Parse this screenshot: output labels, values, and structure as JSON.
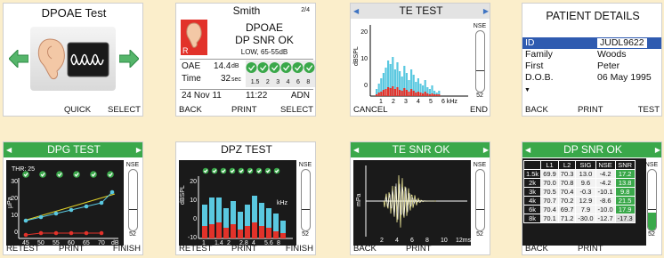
{
  "s1": {
    "title": "DPOAE Test",
    "foot_left": "QUICK",
    "foot_right": "SELECT",
    "icons": [
      "arrow-left-icon",
      "ear-waveform-icon",
      "arrow-right-icon"
    ]
  },
  "s2": {
    "name": "Smith",
    "page": "2/4",
    "test": "DPOAE",
    "result": "DP SNR OK",
    "range": "LOW, 65-55dB",
    "ear": "R",
    "oae_label": "OAE",
    "oae_value": "14.4",
    "oae_unit": "dB",
    "time_label": "Time",
    "time_value": "32",
    "time_unit": "sec",
    "freqs": [
      "1.5",
      "2",
      "3",
      "4",
      "6",
      "8"
    ],
    "date": "24 Nov 11",
    "clock": "11:22",
    "adn": "ADN",
    "foot_left": "BACK",
    "foot_mid": "PRINT",
    "foot_right": "SELECT"
  },
  "s3": {
    "title": "TE TEST",
    "y_label": "dBSPL",
    "y_ticks": [
      "20",
      "10",
      "0"
    ],
    "x_ticks": [
      "1",
      "2",
      "3",
      "4",
      "5",
      "6 kHz"
    ],
    "nse": "NSE",
    "nse_val": "52",
    "foot_left": "CANCEL",
    "foot_right": "END"
  },
  "s4": {
    "title": "PATIENT DETAILS",
    "rows": [
      [
        "ID",
        "JUDL9622"
      ],
      [
        "Family",
        "Woods"
      ],
      [
        "First",
        "Peter"
      ],
      [
        "D.O.B.",
        "06 May 1995"
      ]
    ],
    "foot_left": "BACK",
    "foot_mid": "PRINT",
    "foot_right": "TEST"
  },
  "s5": {
    "title": "DPG TEST",
    "thr": "THR: 25",
    "y_label": "μPa",
    "y_ticks": [
      "30",
      "20",
      "10",
      "0"
    ],
    "x_ticks": [
      "45",
      "50",
      "55",
      "60",
      "65",
      "70"
    ],
    "x_unit": "dB",
    "nse": "NSE",
    "nse_val": "52",
    "foot_left": "RETEST",
    "foot_mid": "PRINT",
    "foot_right": "FINISH"
  },
  "s6": {
    "title": "DPZ TEST",
    "y_label": "dBSPL",
    "y_ticks": [
      "20",
      "10",
      "0",
      "-10"
    ],
    "x_ticks": [
      "1",
      "1.4",
      "2",
      "2.8",
      "4",
      "5.6",
      "8"
    ],
    "x_unit": "kHz",
    "nse": "NSE",
    "nse_val": "52",
    "foot_left": "RETEST",
    "foot_mid": "PRINT",
    "foot_right": "FINISH"
  },
  "s7": {
    "title": "TE SNR OK",
    "y_label": "mPa",
    "x_ticks": [
      "2",
      "4",
      "6",
      "8",
      "10",
      "12ms"
    ],
    "nse": "NSE",
    "nse_val": "52",
    "foot_left": "BACK",
    "foot_mid": "PRINT"
  },
  "s8": {
    "title": "DP SNR OK",
    "headers": [
      "",
      "L1",
      "L2",
      "SIG",
      "NSE",
      "SNR"
    ],
    "rows": [
      [
        "1.5k",
        "69.9",
        "70.3",
        "13.0",
        "-4.2",
        "17.2"
      ],
      [
        "2k",
        "70.0",
        "70.8",
        "9.6",
        "-4.2",
        "13.8"
      ],
      [
        "3k",
        "70.5",
        "70.4",
        "-0.3",
        "-10.1",
        "9.8"
      ],
      [
        "4k",
        "70.7",
        "70.2",
        "12.9",
        "-8.6",
        "21.5"
      ],
      [
        "6k",
        "70.4",
        "69.7",
        "7.9",
        "-10.0",
        "17.9"
      ],
      [
        "8k",
        "70.1",
        "71.2",
        "-30.0",
        "-12.7",
        "-17.3"
      ]
    ],
    "nse": "NSE",
    "nse_val": "52",
    "foot_left": "BACK",
    "foot_mid": "PRINT"
  },
  "colors": {
    "green": "#3aa84a",
    "cyan": "#5ac8e0",
    "red": "#e2322a",
    "blue": "#2f5bb0",
    "bg": "#fbeecb"
  }
}
